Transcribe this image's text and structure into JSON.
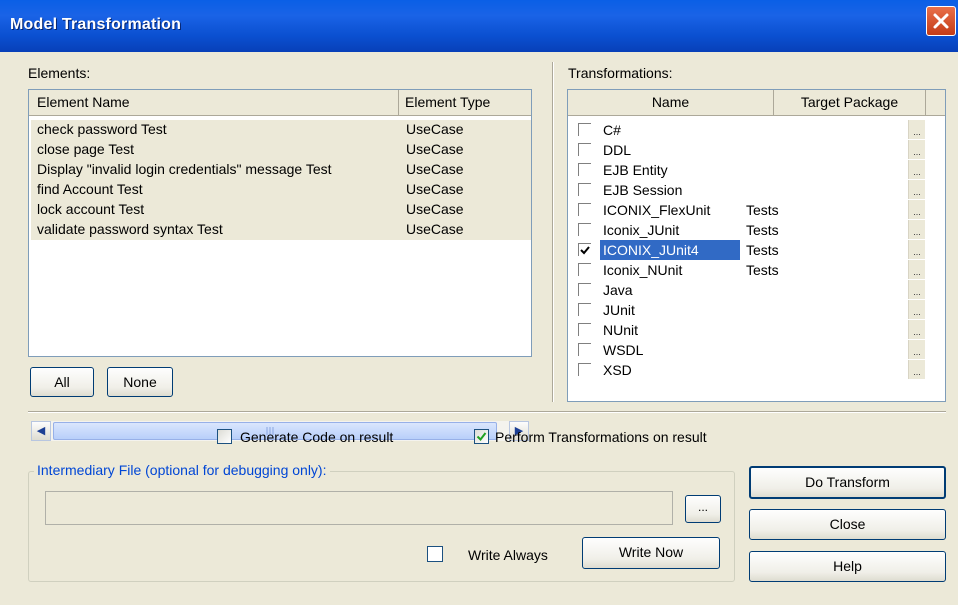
{
  "window": {
    "title": "Model Transformation"
  },
  "elements": {
    "label": "Elements:",
    "columns": [
      "Element Name",
      "Element Type"
    ],
    "rows": [
      {
        "name": "check password Test",
        "type": "UseCase"
      },
      {
        "name": "close page Test",
        "type": "UseCase"
      },
      {
        "name": "Display \"invalid login credentials\" message Test",
        "type": "UseCase"
      },
      {
        "name": "find Account Test",
        "type": "UseCase"
      },
      {
        "name": "lock account Test",
        "type": "UseCase"
      },
      {
        "name": "validate password syntax Test",
        "type": "UseCase"
      }
    ],
    "all_label": "All",
    "none_label": "None"
  },
  "transformations": {
    "label": "Transformations:",
    "columns": [
      "Name",
      "Target Package"
    ],
    "ellipsis": "...",
    "rows": [
      {
        "name": "C#",
        "package": "",
        "checked": false
      },
      {
        "name": "DDL",
        "package": "",
        "checked": false
      },
      {
        "name": "EJB Entity",
        "package": "",
        "checked": false
      },
      {
        "name": "EJB Session",
        "package": "",
        "checked": false
      },
      {
        "name": "ICONIX_FlexUnit",
        "package": "Tests",
        "checked": false
      },
      {
        "name": "Iconix_JUnit",
        "package": "Tests",
        "checked": false
      },
      {
        "name": "ICONIX_JUnit4",
        "package": "Tests",
        "checked": true
      },
      {
        "name": "Iconix_NUnit",
        "package": "Tests",
        "checked": false
      },
      {
        "name": "Java",
        "package": "",
        "checked": false
      },
      {
        "name": "JUnit",
        "package": "",
        "checked": false
      },
      {
        "name": "NUnit",
        "package": "",
        "checked": false
      },
      {
        "name": "WSDL",
        "package": "",
        "checked": false
      },
      {
        "name": "XSD",
        "package": "",
        "checked": false
      }
    ]
  },
  "options": {
    "generate_code_label": "Generate Code on result",
    "generate_code_checked": false,
    "perform_transformations_label": "Perform Transformations on result",
    "perform_transformations_checked": true
  },
  "intermediary": {
    "legend": "Intermediary File (optional for debugging only):",
    "path_value": "",
    "browse_label": "...",
    "write_always_label": "Write Always",
    "write_now_label": "Write Now"
  },
  "actions": {
    "do_transform_label": "Do Transform",
    "close_label": "Close",
    "help_label": "Help"
  }
}
